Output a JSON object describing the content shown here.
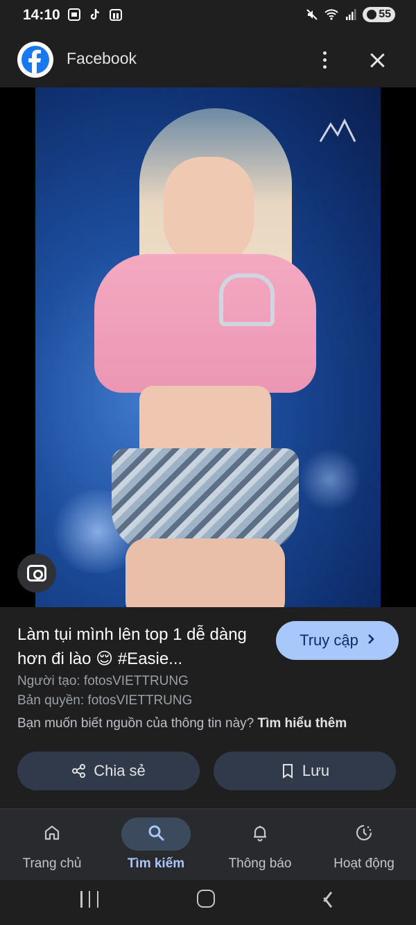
{
  "status_bar": {
    "time": "14:10",
    "battery": "55",
    "left_icons": [
      "screenshot-icon",
      "tiktok-icon",
      "gallery-icon"
    ],
    "right_icons": [
      "mute-icon",
      "wifi-icon",
      "signal-icon",
      "battery-icon"
    ]
  },
  "app_bar": {
    "title": "Facebook",
    "logo": "facebook-logo"
  },
  "image": {
    "lens_icon": "google-lens-icon"
  },
  "info": {
    "title": "Làm tụi mình lên top 1 dễ dàng hơn đi lào 😌 #Easie...",
    "visit_label": "Truy cập",
    "creator": "Người tạo: fotosVIETTRUNG",
    "copyright": "Bản quyền: fotosVIETTRUNG",
    "source_question": "Bạn muốn biết nguồn của thông tin này?",
    "learn_more": "Tìm hiểu thêm",
    "share_label": "Chia sẻ",
    "save_label": "Lưu"
  },
  "bottom_nav": {
    "items": [
      {
        "label": "Trang chủ",
        "icon": "home-icon",
        "active": false
      },
      {
        "label": "Tìm kiếm",
        "icon": "search-icon",
        "active": true
      },
      {
        "label": "Thông báo",
        "icon": "bell-icon",
        "active": false
      },
      {
        "label": "Hoạt động",
        "icon": "activity-icon",
        "active": false
      }
    ]
  },
  "colors": {
    "background": "#1f1f1f",
    "accent": "#a8c7fa",
    "button_bg": "#303a4a",
    "nav_bg": "#282a2d"
  }
}
